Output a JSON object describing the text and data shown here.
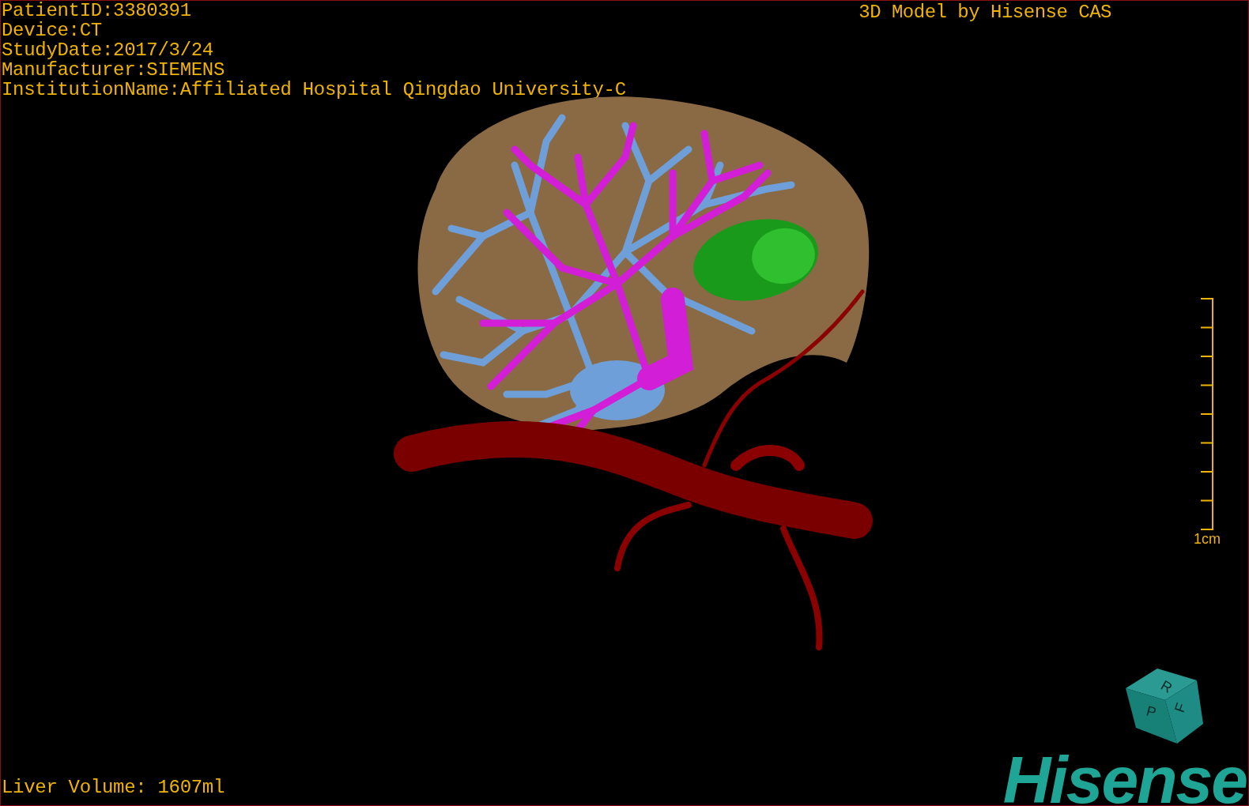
{
  "info": [
    "PatientID:3380391",
    "Device:CT",
    "StudyDate:2017/3/24",
    "Manufacturer:SIEMENS",
    "InstitutionName:Affiliated Hospital Qingdao University-C"
  ],
  "title": "3D Model by Hisense CAS",
  "scale": {
    "label": "1cm"
  },
  "liver_volume": "Liver Volume: 1607ml",
  "cube": {
    "faces": [
      "R",
      "F",
      "P"
    ]
  },
  "logo": "Hisense"
}
